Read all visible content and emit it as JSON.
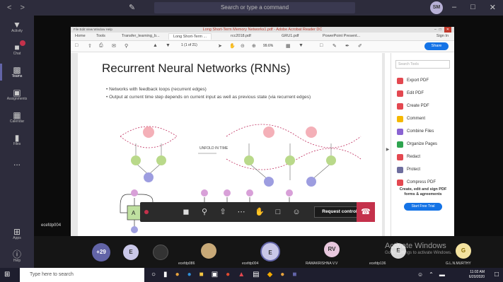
{
  "teams": {
    "search_placeholder": "Search or type a command",
    "user_initials": "SM",
    "rail": [
      {
        "label": "Activity",
        "icon": "bell-icon"
      },
      {
        "label": "Chat",
        "icon": "chat-icon"
      },
      {
        "label": "Teams",
        "icon": "teams-icon"
      },
      {
        "label": "Assignments",
        "icon": "assignments-icon"
      },
      {
        "label": "Calendar",
        "icon": "calendar-icon"
      },
      {
        "label": "Files",
        "icon": "files-icon"
      },
      {
        "label": "...",
        "icon": "more-icon"
      }
    ],
    "rail_bottom": [
      {
        "label": "Apps",
        "icon": "apps-icon"
      },
      {
        "label": "Help",
        "icon": "help-icon"
      }
    ],
    "self_label": "ecefdp004"
  },
  "acrobat": {
    "title": "Long Short-Term Memory Networks1.pdf - Adobe Acrobat Reader DC",
    "menu": "File  Edit  View  Window  Help",
    "tabs": [
      "Home",
      "Tools",
      "Transfer_learning_b...",
      "Long Short-Term ...",
      "rcc2018.pdf",
      "GRU1.pdf",
      "PowerPoint Present..."
    ],
    "sign_in": "Sign In",
    "page": "1",
    "page_total": "(1 of 21)",
    "zoom": "99.6%",
    "share": "Share",
    "slide_title": "Recurrent Neural Networks (RNNs)",
    "bullets": [
      "Networks with feedback loops (recurrent edges)",
      "Output at current time step depends on current input as well as previous state (via recurrent edges)"
    ],
    "unfold_label": "UNFOLD IN TIME",
    "right_pane": {
      "search_placeholder": "Search Tools",
      "items": [
        {
          "label": "Export PDF",
          "color": "#e34850"
        },
        {
          "label": "Edit PDF",
          "color": "#e34850"
        },
        {
          "label": "Create PDF",
          "color": "#e34850"
        },
        {
          "label": "Comment",
          "color": "#f5b800"
        },
        {
          "label": "Combine Files",
          "color": "#8a63d2"
        },
        {
          "label": "Organize Pages",
          "color": "#2ea44f"
        },
        {
          "label": "Redact",
          "color": "#e34850"
        },
        {
          "label": "Protect",
          "color": "#6e6e9e"
        },
        {
          "label": "Compress PDF",
          "color": "#e34850"
        }
      ],
      "promo": "Create, edit and sign PDF forms & agreements",
      "trial": "Start Free Trial"
    }
  },
  "controls": {
    "request_control": "Request control"
  },
  "participants": [
    {
      "initials": "+29",
      "name": "",
      "color": "#6264a7"
    },
    {
      "initials": "E",
      "name": "",
      "color": "#c9c7e8"
    },
    {
      "initials": "",
      "name": "",
      "color": "#333"
    },
    {
      "initials": "",
      "name": "ecefdp086",
      "color": "#c8a978"
    },
    {
      "initials": "E",
      "name": "ecefdp004",
      "color": "#c9c7e8"
    },
    {
      "initials": "RV",
      "name": "RAMAKRISHNA V.V",
      "color": "#e8c8de"
    },
    {
      "initials": "E",
      "name": "ecefdp136",
      "color": "#d8d8d8"
    },
    {
      "initials": "G",
      "name": "G.L.N.MURTHY",
      "color": "#f4e3a0"
    }
  ],
  "watermark": {
    "title": "Activate Windows",
    "subtitle": "Go to Settings to activate Windows."
  },
  "taskbar": {
    "search_placeholder": "Type here to search",
    "time": "11:02 AM",
    "date": "6/20/2020"
  }
}
